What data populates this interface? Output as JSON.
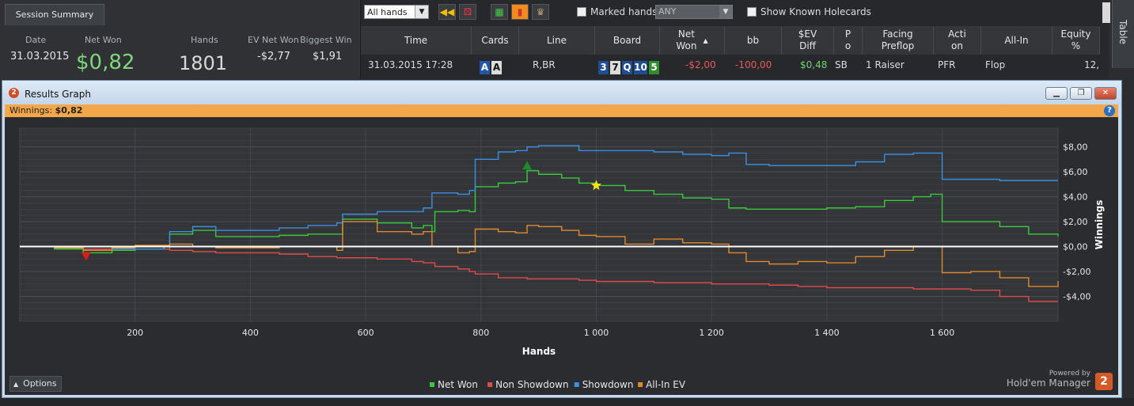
{
  "summary": {
    "tab": "Session Summary",
    "headers": {
      "date": "Date",
      "net_won": "Net Won",
      "hands": "Hands",
      "ev_net_won": "EV Net Won",
      "biggest_win": "Biggest Win"
    },
    "values": {
      "date": "31.03.2015",
      "net_won": "$0,82",
      "hands": "1801",
      "ev_net_won": "-$2,77",
      "biggest_win": "$1,91"
    }
  },
  "toolbar": {
    "filter": "All hands",
    "marked_hands": "Marked hands",
    "any_placeholder": "ANY",
    "show_known": "Show Known Holecards"
  },
  "grid": {
    "columns": [
      "Time",
      "Cards",
      "Line",
      "Board",
      "Net\nWon",
      "bb",
      "$EV\nDiff",
      "P\no",
      "Facing\nPreflop",
      "Acti\non",
      "All-In",
      "Equity\n%"
    ],
    "row": {
      "time": "31.03.2015 17:28",
      "cards": [
        "A",
        "A"
      ],
      "line": "R,BR",
      "board": [
        "3",
        "7",
        "Q",
        "10",
        "5"
      ],
      "net_won": "-$2,00",
      "bb": "-100,00",
      "ev_diff": "$0,48",
      "position": "SB",
      "facing": "1 Raiser",
      "action": "PFR",
      "allin": "Flop",
      "equity": "12,"
    }
  },
  "side_tab": "Table",
  "window": {
    "title": "Results Graph",
    "winnings_label": "Winnings:",
    "winnings_value": "$0,82",
    "options": "Options",
    "powered_by": "Powered by",
    "product": "Hold'em Manager"
  },
  "chart_data": {
    "type": "line",
    "xlabel": "Hands",
    "ylabel": "Winnings",
    "xlim": [
      0,
      1801
    ],
    "ylim": [
      -6,
      9.5
    ],
    "x_ticks": [
      200,
      400,
      600,
      800,
      1000,
      1200,
      1400,
      1600
    ],
    "x_tick_labels": [
      "200",
      "400",
      "600",
      "800",
      "1 000",
      "1 200",
      "1 400",
      "1 600"
    ],
    "y_ticks": [
      8,
      6,
      4,
      2,
      0,
      -2,
      -4
    ],
    "y_tick_labels": [
      "$8,00",
      "$6,00",
      "$4,00",
      "$2,00",
      "$0,00",
      "-$2,00",
      "-$4,00"
    ],
    "grid": true,
    "legend_position": "bottom",
    "x": [
      0,
      60,
      110,
      160,
      200,
      250,
      260,
      300,
      340,
      400,
      450,
      500,
      550,
      560,
      620,
      680,
      700,
      715,
      720,
      760,
      780,
      790,
      830,
      860,
      880,
      900,
      940,
      970,
      1000,
      1050,
      1100,
      1150,
      1200,
      1230,
      1260,
      1300,
      1350,
      1400,
      1450,
      1500,
      1550,
      1580,
      1600,
      1650,
      1700,
      1750,
      1801
    ],
    "series": [
      {
        "name": "Net Won",
        "color": "#3cc83c",
        "values": [
          0,
          -0.2,
          -0.5,
          -0.3,
          -0.2,
          -0.2,
          1.0,
          1.3,
          0.8,
          0.8,
          0.9,
          1.0,
          1.0,
          2.2,
          1.9,
          1.5,
          1.7,
          1.2,
          2.8,
          2.9,
          2.8,
          4.8,
          5.1,
          5.2,
          6.1,
          5.8,
          5.5,
          5.1,
          4.9,
          4.5,
          4.2,
          3.9,
          3.8,
          3.1,
          3.0,
          3.0,
          3.0,
          3.1,
          3.2,
          3.7,
          4.0,
          4.2,
          2.0,
          2.0,
          1.6,
          1.0,
          0.82
        ]
      },
      {
        "name": "Non Showdown",
        "color": "#e14b4b",
        "values": [
          0,
          -0.1,
          -0.2,
          -0.1,
          0.0,
          -0.2,
          -0.3,
          -0.4,
          -0.5,
          -0.5,
          -0.6,
          -0.8,
          -0.9,
          -0.9,
          -1.0,
          -1.2,
          -1.3,
          -1.3,
          -1.6,
          -1.8,
          -2.0,
          -2.2,
          -2.5,
          -2.5,
          -2.6,
          -2.6,
          -2.6,
          -2.7,
          -2.8,
          -2.8,
          -2.9,
          -2.9,
          -3.0,
          -3.0,
          -3.0,
          -3.1,
          -3.2,
          -3.3,
          -3.3,
          -3.3,
          -3.4,
          -3.4,
          -3.4,
          -3.5,
          -4.0,
          -4.4,
          -4.4
        ]
      },
      {
        "name": "Showdown",
        "color": "#3c8fe0",
        "values": [
          0,
          -0.1,
          -0.3,
          -0.2,
          -0.2,
          0.0,
          1.2,
          1.6,
          1.3,
          1.3,
          1.5,
          1.7,
          1.9,
          2.6,
          2.8,
          2.8,
          3.1,
          4.3,
          4.3,
          4.2,
          4.5,
          7.0,
          7.6,
          7.7,
          8.0,
          8.1,
          8.1,
          7.7,
          7.7,
          7.7,
          7.6,
          7.4,
          7.3,
          7.5,
          6.6,
          6.5,
          6.5,
          6.5,
          6.8,
          7.4,
          7.5,
          7.5,
          5.4,
          5.4,
          5.3,
          5.3,
          5.3
        ]
      },
      {
        "name": "All-In EV",
        "color": "#e08a2e",
        "values": [
          0,
          -0.1,
          -0.3,
          -0.1,
          0.1,
          0.1,
          0.2,
          0.0,
          -0.1,
          -0.1,
          0.0,
          0.0,
          -0.3,
          2.0,
          1.2,
          1.0,
          1.2,
          0.0,
          0.0,
          -0.5,
          -0.4,
          1.4,
          1.2,
          1.1,
          1.7,
          1.6,
          1.3,
          0.9,
          0.8,
          0.2,
          0.6,
          0.3,
          0.2,
          -0.5,
          -1.2,
          -1.4,
          -1.2,
          -1.3,
          -0.8,
          -0.3,
          0.0,
          0.0,
          -2.1,
          -2.0,
          -2.5,
          -3.2,
          -2.77
        ]
      }
    ],
    "markers": [
      {
        "kind": "min",
        "x": 115,
        "y": -0.8,
        "color": "#e01818"
      },
      {
        "kind": "max",
        "x": 880,
        "y": 6.5,
        "color": "#1a8a2a"
      },
      {
        "kind": "star",
        "x": 1000,
        "y": 4.9,
        "color": "#ffe31a"
      }
    ],
    "zero_line_color": "#ffffff"
  }
}
